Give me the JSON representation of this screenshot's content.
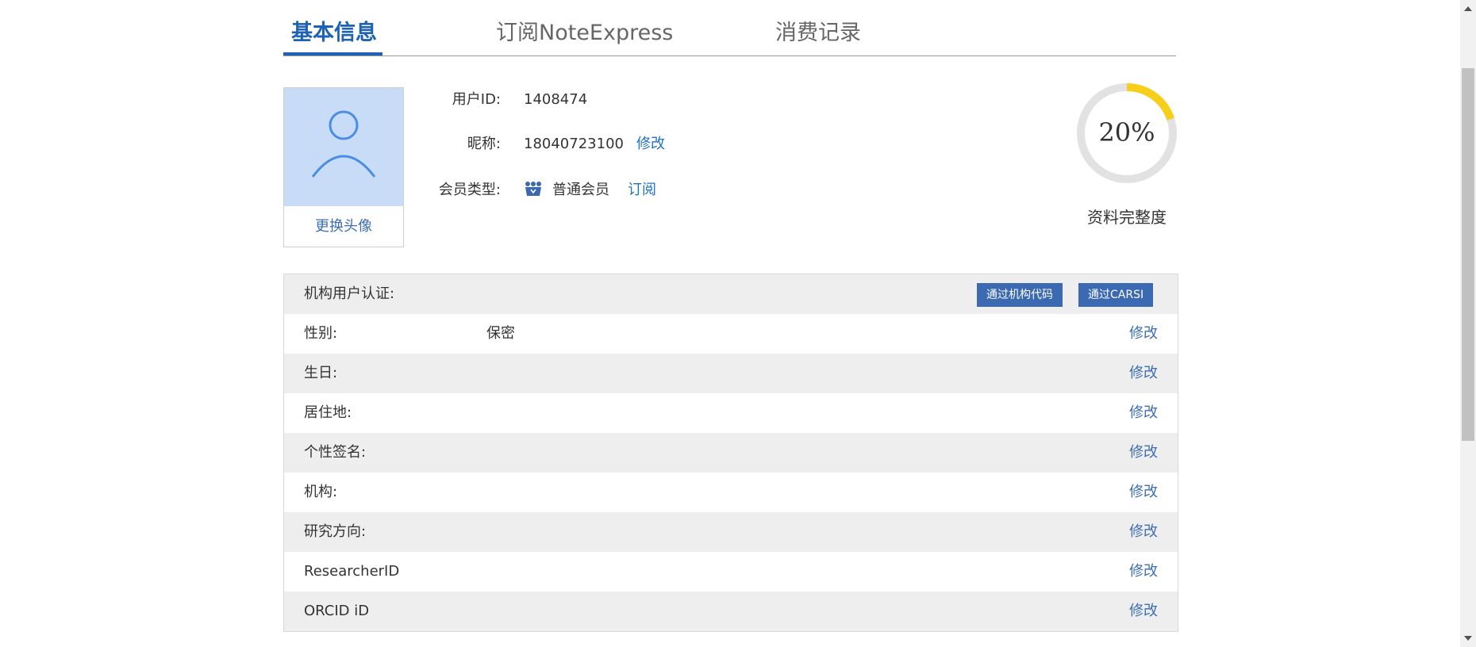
{
  "tabs": [
    {
      "label": "基本信息",
      "active": true
    },
    {
      "label": "订阅NoteExpress",
      "active": false
    },
    {
      "label": "消费记录",
      "active": false
    }
  ],
  "avatar": {
    "change_label": "更换头像",
    "icon": "user-icon"
  },
  "profile": {
    "user_id_label": "用户ID:",
    "user_id": "1408474",
    "nickname_label": "昵称:",
    "nickname": "18040723100",
    "nickname_edit": "修改",
    "member_type_label": "会员类型:",
    "member_type": "普通会员",
    "member_icon": "crown-icon",
    "subscribe_label": "订阅"
  },
  "completeness": {
    "percent": 20,
    "percent_text": "20%",
    "caption": "资料完整度"
  },
  "institution": {
    "label": "机构用户认证:",
    "btn_code": "通过机构代码",
    "btn_carsi": "通过CARSI"
  },
  "rows": [
    {
      "label": "性别:",
      "value": "保密",
      "edit": "修改"
    },
    {
      "label": "生日:",
      "value": "",
      "edit": "修改"
    },
    {
      "label": "居住地:",
      "value": "",
      "edit": "修改"
    },
    {
      "label": "个性签名:",
      "value": "",
      "edit": "修改"
    },
    {
      "label": "机构:",
      "value": "",
      "edit": "修改"
    },
    {
      "label": "研究方向:",
      "value": "",
      "edit": "修改"
    },
    {
      "label": "ResearcherID",
      "value": "",
      "edit": "修改"
    },
    {
      "label": "ORCID iD",
      "value": "",
      "edit": "修改"
    }
  ],
  "colors": {
    "accent": "#1e62b4",
    "ring_fill": "#f7cf1a",
    "ring_track": "#e2e2e2",
    "button": "#3b69b2"
  }
}
